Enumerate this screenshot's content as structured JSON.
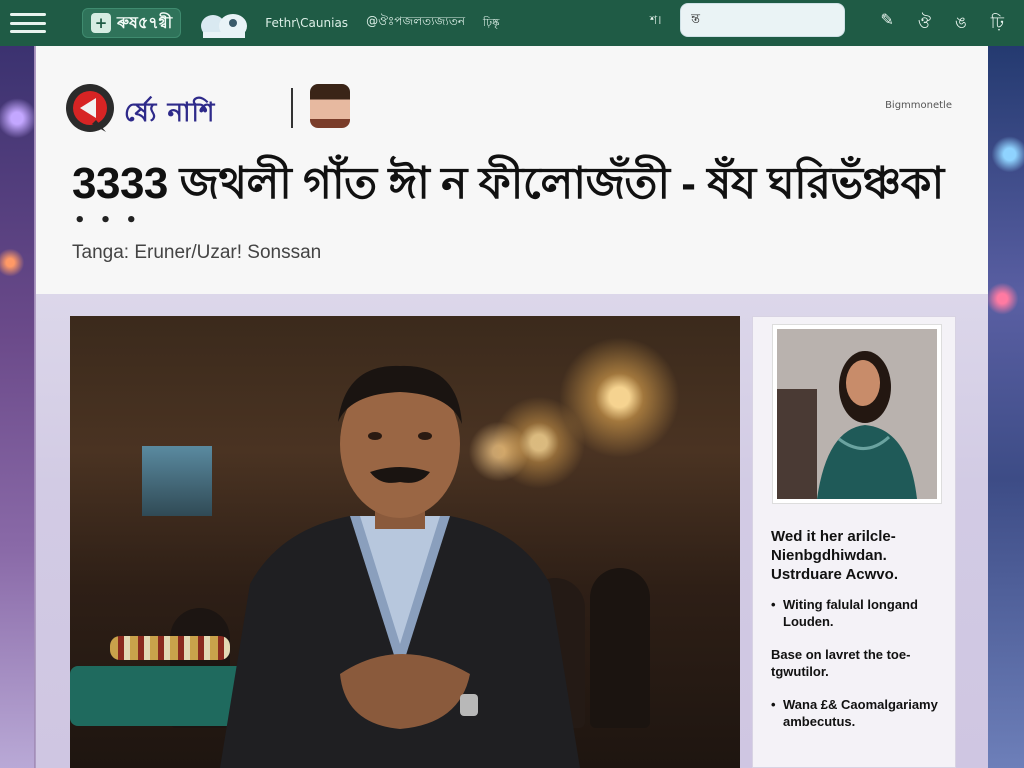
{
  "topbar": {
    "brand_plus": "+",
    "brand": "ৰুষ৫৭গ্বী",
    "nav": [
      "Fethr\\Caunias",
      "@ঔঃপজলত্যজ্যতন",
      "ঢ়িষ্কৃ"
    ],
    "page_label": "শ।",
    "search": {
      "value": "ন্ত",
      "placeholder": ""
    },
    "icons": [
      "edit-icon",
      "user-icon",
      "translate-icon",
      "settings-icon"
    ],
    "icon_glyphs": [
      "✎",
      "ঔ",
      "ঙ",
      "ঢ়ি"
    ]
  },
  "header": {
    "site_name": "ৰ্ষ্যে নাশি",
    "tagline": "Bigmmonetle",
    "headline": "3333 জথলী গাঁত ঈা ন ফীলোজঁতী - ষঁয ঘরিভঁঞ্চকা",
    "dots": "• • •",
    "byline": "Tanga:  Eruner/Uzar!  Sonssan"
  },
  "side_panel": {
    "lead": "Wed it her arilcle- Nienbgdhiwdan. Ustrduare Acwvo.",
    "items": [
      {
        "text": "Witing falulal longand Louden.",
        "bullet": true
      },
      {
        "text": "Base on lavret the toe- tgwutilor.",
        "bullet": false
      },
      {
        "text": "Wana £& Caomalgariamy ambecutus.",
        "bullet": true
      }
    ]
  },
  "colors": {
    "topbar": "#1f5b45",
    "brand_blue": "#2e2a8a",
    "accent": "#e02b2b"
  }
}
